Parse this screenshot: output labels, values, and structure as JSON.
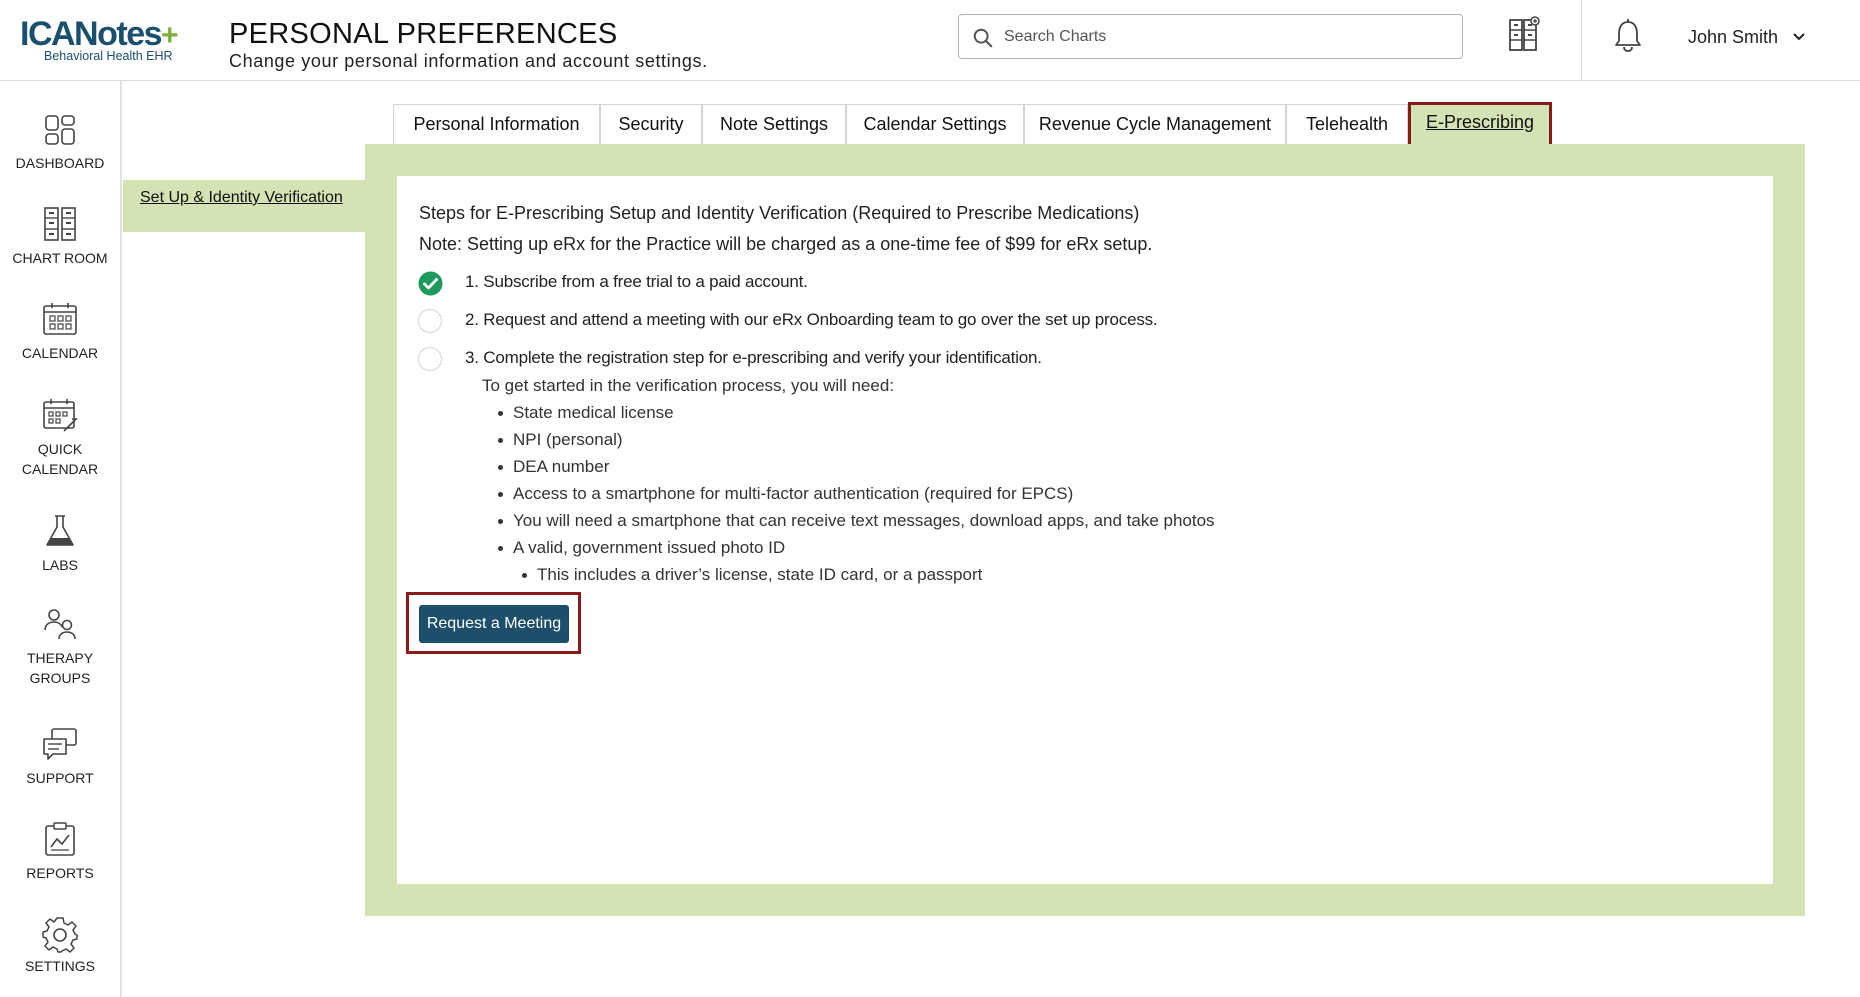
{
  "app": {
    "logo_text": "ICANotes",
    "logo_plus": "+",
    "logo_tagline": "Behavioral Health EHR"
  },
  "header": {
    "title": "PERSONAL PREFERENCES",
    "subtitle": "Change your personal information and account settings.",
    "search_placeholder": "Search Charts",
    "user_name": "John Smith"
  },
  "nav": {
    "dashboard": "DASHBOARD",
    "chart_room": "CHART ROOM",
    "calendar": "CALENDAR",
    "quick_calendar_1": "QUICK",
    "quick_calendar_2": "CALENDAR",
    "labs": "LABS",
    "therapy_groups_1": "THERAPY",
    "therapy_groups_2": "GROUPS",
    "support": "SUPPORT",
    "reports": "REPORTS",
    "settings": "SETTINGS"
  },
  "tabs": {
    "personal_information": "Personal Information",
    "security": "Security",
    "note_settings": "Note Settings",
    "calendar_settings": "Calendar Settings",
    "revenue_cycle": "Revenue Cycle Management",
    "telehealth": "Telehealth",
    "e_prescribing": "E-Prescribing"
  },
  "subnav": {
    "setup_identity": "Set Up & Identity Verification"
  },
  "content": {
    "heading_1": "Steps for E-Prescribing Setup and Identity Verification (Required to Prescribe Medications)",
    "heading_2": "Note: Setting up eRx for the Practice will be charged as a one-time fee of $99 for eRx setup.",
    "steps": [
      {
        "text": "1. Subscribe from a free trial to a paid account.",
        "done": true
      },
      {
        "text": "2. Request and attend a meeting with our eRx Onboarding team to go over the set up process.",
        "done": false
      },
      {
        "text": "3. Complete the registration step for e-prescribing and verify your identification.",
        "done": false
      }
    ],
    "requirements_intro": "To get started in the verification process, you will need:",
    "requirements": [
      "State medical license",
      "NPI (personal)",
      "DEA number",
      "Access to a smartphone for multi-factor authentication (required for EPCS)",
      "You will need a smartphone that can receive text messages, download apps, and take photos",
      "A valid, government issued photo ID"
    ],
    "sub_requirement": "This includes a driver’s license, state ID card, or a passport",
    "request_button": "Request a Meeting"
  },
  "colors": {
    "brand": "#1a4f6e",
    "accent_green": "#7fae3c",
    "panel_green": "#d3e3b3",
    "highlight_red": "#8b1a1a",
    "button_blue": "#1d4f6a",
    "check_green": "#1e9a5c"
  },
  "icons": {
    "search": "search-icon",
    "charts": "charts-icon",
    "bell": "bell-icon",
    "chevron": "chevron-down-icon"
  }
}
